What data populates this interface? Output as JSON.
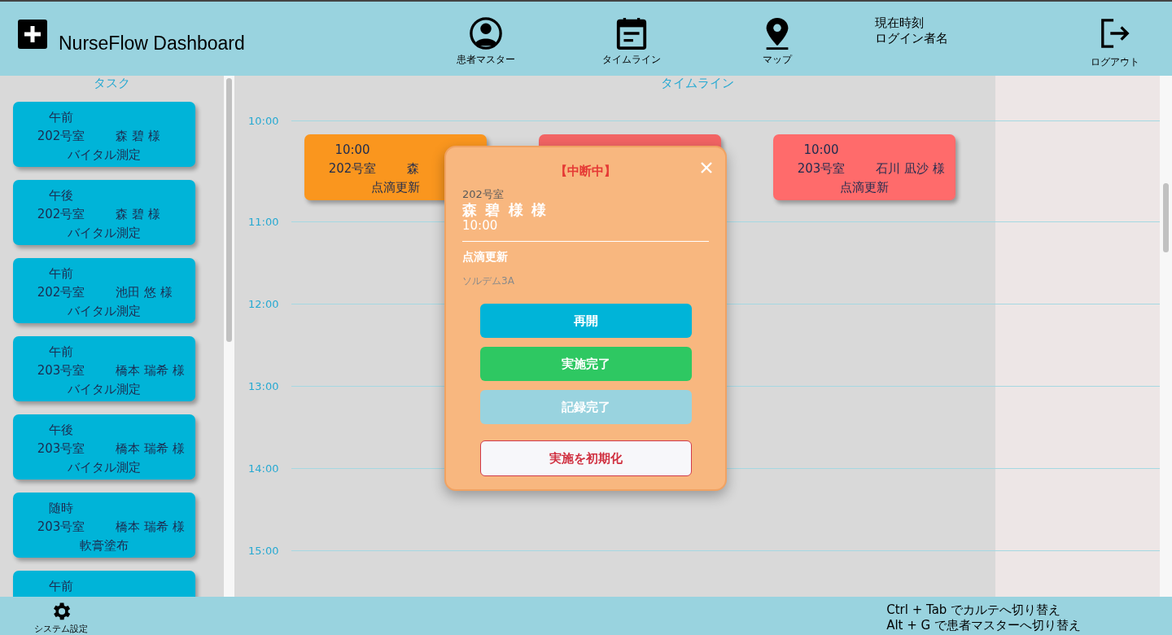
{
  "header": {
    "title": "NurseFlow Dashboard",
    "nav": [
      {
        "label": "患者マスター",
        "kind": "patient"
      },
      {
        "label": "タイムライン",
        "kind": "timeline"
      },
      {
        "label": "マップ",
        "kind": "map"
      }
    ],
    "info": [
      "現在時刻",
      "ログイン者名"
    ],
    "logout": "ログアウト"
  },
  "sidebar": {
    "title": "タスク",
    "tasks": [
      {
        "period": "午前",
        "room": "202号室",
        "name": "森 碧 様",
        "task": "バイタル測定"
      },
      {
        "period": "午後",
        "room": "202号室",
        "name": "森 碧 様",
        "task": "バイタル測定"
      },
      {
        "period": "午前",
        "room": "202号室",
        "name": "池田 悠 様",
        "task": "バイタル測定"
      },
      {
        "period": "午前",
        "room": "203号室",
        "name": "橋本 瑞希 様",
        "task": "バイタル測定"
      },
      {
        "period": "午後",
        "room": "203号室",
        "name": "橋本 瑞希 様",
        "task": "バイタル測定"
      },
      {
        "period": "随時",
        "room": "203号室",
        "name": "橋本 瑞希 様",
        "task": "軟膏塗布"
      },
      {
        "period": "午前"
      }
    ]
  },
  "timeline": {
    "title": "タイムライン",
    "hours": [
      {
        "time": "10:00",
        "events": [
          {
            "time": "10:00",
            "room": "202号室",
            "name": "森",
            "task": "点滴更新",
            "color": "#fa961e"
          },
          {
            "color": "#f26464"
          },
          {
            "time": "10:00",
            "room": "203号室",
            "name": "石川 凪沙 様",
            "task": "点滴更新",
            "color": "#ff6b6b"
          }
        ]
      },
      {
        "time": "11:00"
      },
      {
        "time": "12:00"
      },
      {
        "time": "13:00"
      },
      {
        "time": "14:00"
      },
      {
        "time": "15:00"
      }
    ]
  },
  "popup": {
    "status": "【中断中】",
    "room": "202号室",
    "name": "森 碧 様 様",
    "time": "10:00",
    "task": "点滴更新",
    "detail": "ソルデム3A",
    "buttons": [
      {
        "label": "再開",
        "kind": "resume"
      },
      {
        "label": "実施完了",
        "kind": "done"
      },
      {
        "label": "記録完了",
        "kind": "record"
      },
      {
        "label": "実施を初期化",
        "kind": "reset"
      }
    ]
  },
  "footer": {
    "settings": "システム設定",
    "shortcuts": [
      "Ctrl + Tab でカルテへ切り替え",
      "Alt + G で患者マスターへ切り替え"
    ]
  }
}
